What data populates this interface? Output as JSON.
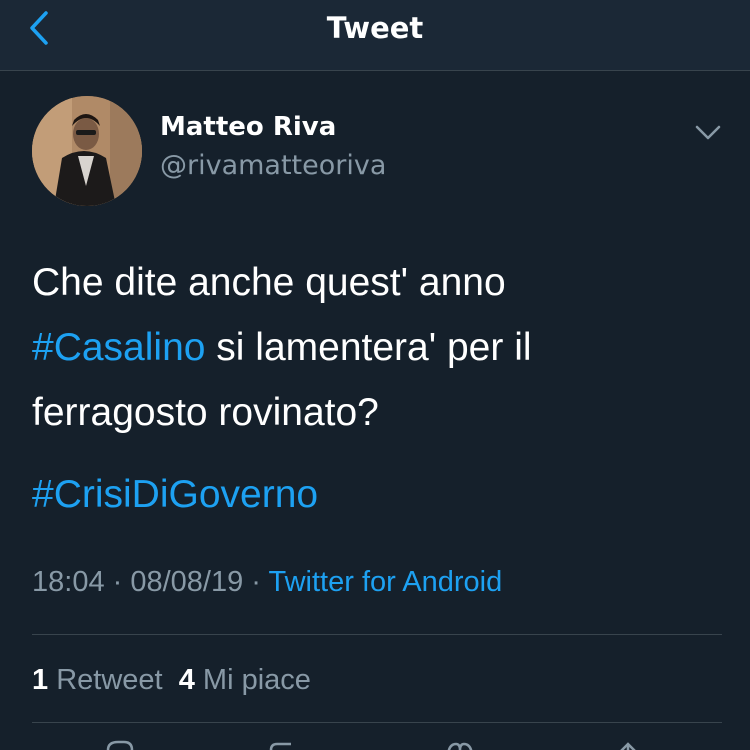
{
  "nav": {
    "title": "Tweet",
    "back_icon": "chevron-left-icon"
  },
  "tweet": {
    "author": {
      "name": "Matteo Riva",
      "handle": "@rivamatteoriva"
    },
    "text_line_1": "Che dite anche quest' anno",
    "hashtag_1": "#Casalino",
    "text_line_2": " si lamentera' per il",
    "text_line_3": "ferragosto rovinato?",
    "hashtag_2": "#CrisiDiGoverno",
    "time": "18:04",
    "date": "08/08/19",
    "separator": " · ",
    "source": "Twitter for Android"
  },
  "stats": {
    "retweets_count": "1",
    "retweets_label": "Retweet",
    "likes_count": "4",
    "likes_label": "Mi piace"
  },
  "colors": {
    "background": "#15202b",
    "accent": "#1da1f2",
    "secondary_text": "#8899a6",
    "divider": "#38444d"
  }
}
